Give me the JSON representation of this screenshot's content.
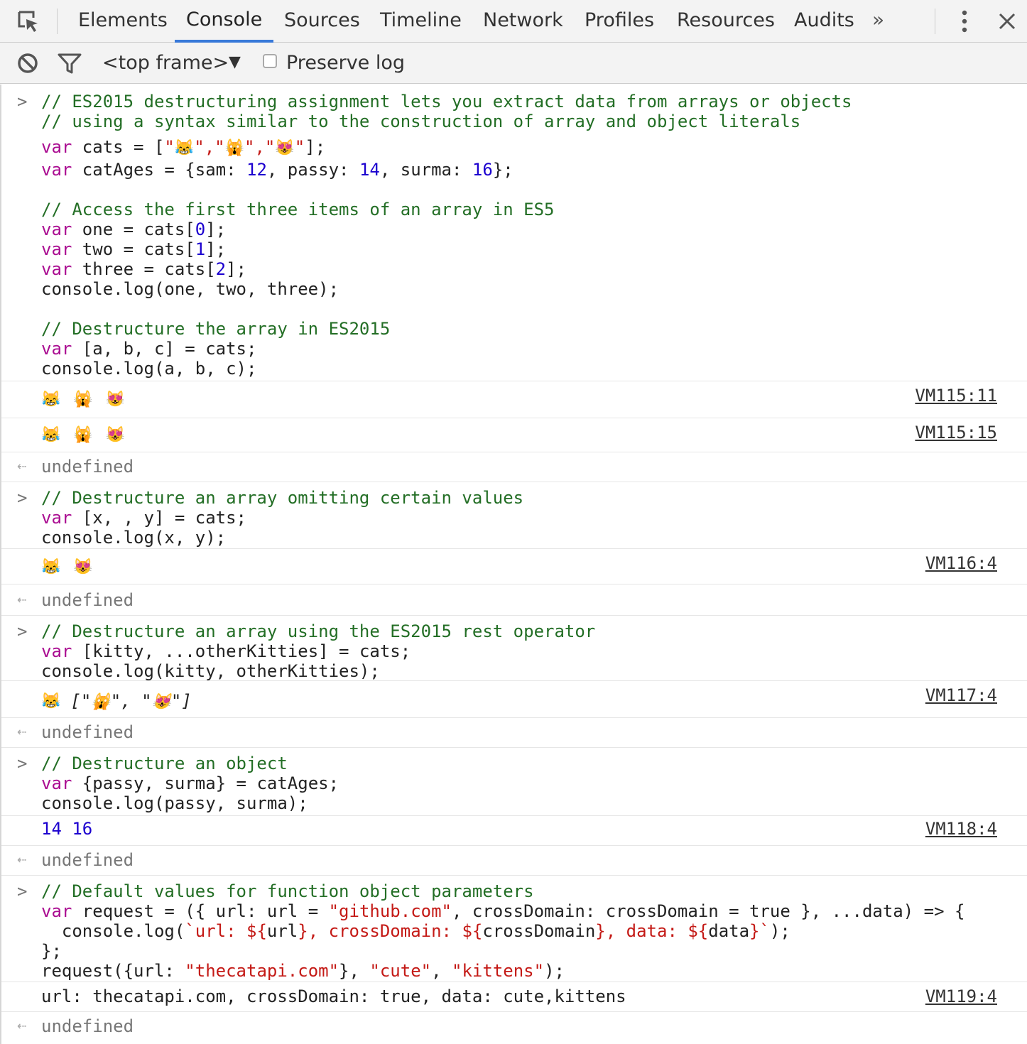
{
  "tabs": {
    "items": [
      "Elements",
      "Console",
      "Sources",
      "Timeline",
      "Network",
      "Profiles",
      "Resources",
      "Audits"
    ],
    "active": "Console",
    "more": "»"
  },
  "toolbar": {
    "frame": "<top frame>",
    "preserve_log": "Preserve log",
    "preserve_checked": false
  },
  "colors": {
    "comment": "#236e25",
    "keyword": "#aa0d91",
    "number": "#1c00cf",
    "string": "#c41a16",
    "active_tab_underline": "#3879d9"
  },
  "emoji": {
    "tears": "😹",
    "scream": "🙀",
    "hearts": "😻"
  },
  "console": {
    "block1": {
      "l1": "// ES2015 destructuring assignment lets you extract data from arrays or objects",
      "l2": "// using a syntax similar to the construction of array and object literals",
      "l3_kw": "var",
      "l3_a": " cats = [",
      "l3_q1": "\"",
      "l3_q2": "\",\"",
      "l3_q3": "\",\"",
      "l3_q4": "\"",
      "l3_end": "];",
      "l4_kw": "var",
      "l4_a": " catAges = {sam: ",
      "l4_n1": "12",
      "l4_b": ", passy: ",
      "l4_n2": "14",
      "l4_c": ", surma: ",
      "l4_n3": "16",
      "l4_end": "};",
      "l6": "// Access the first three items of an array in ES5",
      "l7_kw": "var",
      "l7_a": " one = cats[",
      "l7_n": "0",
      "l7_end": "];",
      "l8_kw": "var",
      "l8_a": " two = cats[",
      "l8_n": "1",
      "l8_end": "];",
      "l9_kw": "var",
      "l9_a": " three = cats[",
      "l9_n": "2",
      "l9_end": "];",
      "l10": "console.log(one, two, three);",
      "l12": "// Destructure the array in ES2015",
      "l13_kw": "var",
      "l13_a": " [a, b, c] = cats;",
      "l14": "console.log(a, b, c);"
    },
    "out1": {
      "link": "VM115:11"
    },
    "out2": {
      "link": "VM115:15"
    },
    "undef1": "undefined",
    "block2": {
      "l1": "// Destructure an array omitting certain values",
      "l2_kw": "var",
      "l2_a": " [x, , y] = cats;",
      "l3": "console.log(x, y);"
    },
    "out3": {
      "link": "VM116:4"
    },
    "undef2": "undefined",
    "block3": {
      "l1": "// Destructure an array using the ES2015 rest operator",
      "l2_kw": "var",
      "l2_a": " [kitty, ...otherKitties] = cats;",
      "l3": "console.log(kitty, otherKitties);"
    },
    "out4": {
      "open": "[\"",
      "mid": "\", \"",
      "close": "\"]",
      "link": "VM117:4"
    },
    "undef3": "undefined",
    "block4": {
      "l1": "// Destructure an object",
      "l2_kw": "var",
      "l2_a": " {passy, surma} = catAges;",
      "l3": "console.log(passy, surma);"
    },
    "out5": {
      "n1": "14",
      "n2": "16",
      "link": "VM118:4"
    },
    "undef4": "undefined",
    "block5": {
      "l1": "// Default values for function object parameters",
      "l2_kw": "var",
      "l2_a": " request = ({ url: url = ",
      "l2_s": "\"github.com\"",
      "l2_b": ", crossDomain: crossDomain = true }, ...data) => {",
      "l3_a": "  console.log(",
      "l3_t1": "`url: ${",
      "l3_b": "url",
      "l3_t2": "}, crossDomain: ${",
      "l3_c": "crossDomain",
      "l3_t3": "}, data: ${",
      "l3_d": "data",
      "l3_t4": "}`",
      "l3_end": ");",
      "l4": "};",
      "l5_a": "request({url: ",
      "l5_s1": "\"thecatapi.com\"",
      "l5_b": "}, ",
      "l5_s2": "\"cute\"",
      "l5_c": ", ",
      "l5_s3": "\"kittens\"",
      "l5_end": ");"
    },
    "out6": {
      "text": "url: thecatapi.com, crossDomain: true, data: cute,kittens",
      "link": "VM119:4"
    },
    "undef5": "undefined"
  }
}
